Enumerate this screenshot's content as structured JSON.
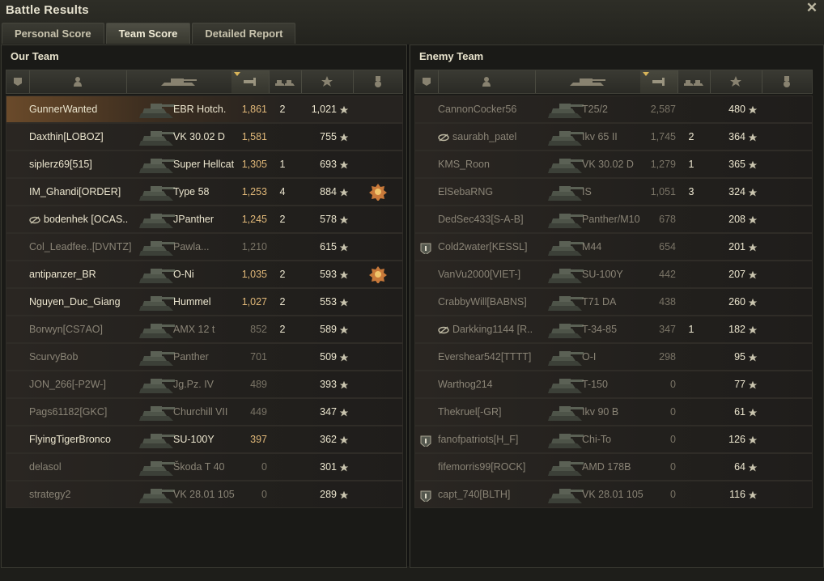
{
  "window": {
    "title": "Battle Results",
    "close_glyph": "✕"
  },
  "tabs": [
    {
      "label": "Personal Score",
      "active": false
    },
    {
      "label": "Team Score",
      "active": true
    },
    {
      "label": "Detailed Report",
      "active": false
    }
  ],
  "columns": [
    "platoon",
    "player",
    "vehicle",
    "damage",
    "kills",
    "xp",
    "medals"
  ],
  "sorted_column": "damage",
  "our_team": {
    "title": "Our Team",
    "rows": [
      {
        "name": "GunnerWanted",
        "tank": "EBR Hotch.",
        "damage": "1,861",
        "kills": "2",
        "xp": "1,021",
        "alive": true,
        "highlight": true,
        "medal": false,
        "platoon": false,
        "hidden": false
      },
      {
        "name": "Daxthin[LOBOZ]",
        "tank": "VK 30.02 D",
        "damage": "1,581",
        "kills": "",
        "xp": "755",
        "alive": true,
        "highlight": false,
        "medal": false,
        "platoon": false,
        "hidden": false
      },
      {
        "name": "siplerz69[515]",
        "tank": "Super Hellcat",
        "damage": "1,305",
        "kills": "1",
        "xp": "693",
        "alive": true,
        "highlight": false,
        "medal": false,
        "platoon": false,
        "hidden": false
      },
      {
        "name": "IM_Ghandi[ORDER]",
        "tank": "Type 58",
        "damage": "1,253",
        "kills": "4",
        "xp": "884",
        "alive": true,
        "highlight": false,
        "medal": true,
        "platoon": false,
        "hidden": false
      },
      {
        "name": "bodenhek [OCAS..",
        "tank": "JPanther",
        "damage": "1,245",
        "kills": "2",
        "xp": "578",
        "alive": true,
        "highlight": false,
        "medal": false,
        "platoon": false,
        "hidden": true
      },
      {
        "name": "Col_Leadfee..[DVNTZ]",
        "tank": "Pawla...",
        "damage": "1,210",
        "kills": "",
        "xp": "615",
        "alive": false,
        "highlight": false,
        "medal": false,
        "platoon": false,
        "hidden": false
      },
      {
        "name": "antipanzer_BR",
        "tank": "O-Ni",
        "damage": "1,035",
        "kills": "2",
        "xp": "593",
        "alive": true,
        "highlight": false,
        "medal": true,
        "platoon": false,
        "hidden": false
      },
      {
        "name": "Nguyen_Duc_Giang",
        "tank": "Hummel",
        "damage": "1,027",
        "kills": "2",
        "xp": "553",
        "alive": true,
        "highlight": false,
        "medal": false,
        "platoon": false,
        "hidden": false
      },
      {
        "name": "Borwyn[CS7AO]",
        "tank": "AMX 12 t",
        "damage": "852",
        "kills": "2",
        "xp": "589",
        "alive": false,
        "highlight": false,
        "medal": false,
        "platoon": false,
        "hidden": false
      },
      {
        "name": "ScurvyBob",
        "tank": "Panther",
        "damage": "701",
        "kills": "",
        "xp": "509",
        "alive": false,
        "highlight": false,
        "medal": false,
        "platoon": false,
        "hidden": false
      },
      {
        "name": "JON_266[-P2W-]",
        "tank": "Jg.Pz. IV",
        "damage": "489",
        "kills": "",
        "xp": "393",
        "alive": false,
        "highlight": false,
        "medal": false,
        "platoon": false,
        "hidden": false
      },
      {
        "name": "Pags61182[GKC]",
        "tank": "Churchill VII",
        "damage": "449",
        "kills": "",
        "xp": "347",
        "alive": false,
        "highlight": false,
        "medal": false,
        "platoon": false,
        "hidden": false
      },
      {
        "name": "FlyingTigerBronco",
        "tank": "SU-100Y",
        "damage": "397",
        "kills": "",
        "xp": "362",
        "alive": true,
        "highlight": false,
        "medal": false,
        "platoon": false,
        "hidden": false
      },
      {
        "name": "delasol",
        "tank": "Škoda T 40",
        "damage": "0",
        "kills": "",
        "xp": "301",
        "alive": false,
        "highlight": false,
        "medal": false,
        "platoon": false,
        "hidden": false
      },
      {
        "name": "strategy2",
        "tank": "VK 28.01 105",
        "damage": "0",
        "kills": "",
        "xp": "289",
        "alive": false,
        "highlight": false,
        "medal": false,
        "platoon": false,
        "hidden": false
      }
    ]
  },
  "enemy_team": {
    "title": "Enemy Team",
    "rows": [
      {
        "name": "CannonCocker56",
        "tank": "T25/2",
        "damage": "2,587",
        "kills": "",
        "xp": "480",
        "alive": false,
        "platoon": false,
        "hidden": false
      },
      {
        "name": "saurabh_patel",
        "tank": "Ikv 65 II",
        "damage": "1,745",
        "kills": "2",
        "xp": "364",
        "alive": false,
        "platoon": false,
        "hidden": true
      },
      {
        "name": "KMS_Roon",
        "tank": "VK 30.02 D",
        "damage": "1,279",
        "kills": "1",
        "xp": "365",
        "alive": false,
        "platoon": false,
        "hidden": false
      },
      {
        "name": "ElSebaRNG",
        "tank": "IS",
        "damage": "1,051",
        "kills": "3",
        "xp": "324",
        "alive": false,
        "platoon": false,
        "hidden": false
      },
      {
        "name": "DedSec433[S-A-B]",
        "tank": "Panther/M10",
        "damage": "678",
        "kills": "",
        "xp": "208",
        "alive": false,
        "platoon": false,
        "hidden": false
      },
      {
        "name": "Cold2water[KESSL]",
        "tank": "M44",
        "damage": "654",
        "kills": "",
        "xp": "201",
        "alive": false,
        "platoon": true,
        "hidden": false
      },
      {
        "name": "VanVu2000[VIET-]",
        "tank": "SU-100Y",
        "damage": "442",
        "kills": "",
        "xp": "207",
        "alive": false,
        "platoon": false,
        "hidden": false
      },
      {
        "name": "CrabbyWill[BABNS]",
        "tank": "T71 DA",
        "damage": "438",
        "kills": "",
        "xp": "260",
        "alive": false,
        "platoon": false,
        "hidden": false
      },
      {
        "name": "Darkking1144 [R..",
        "tank": "T-34-85",
        "damage": "347",
        "kills": "1",
        "xp": "182",
        "alive": false,
        "platoon": false,
        "hidden": true
      },
      {
        "name": "Evershear542[TTTT]",
        "tank": "O-I",
        "damage": "298",
        "kills": "",
        "xp": "95",
        "alive": false,
        "platoon": false,
        "hidden": false
      },
      {
        "name": "Warthog214",
        "tank": "T-150",
        "damage": "0",
        "kills": "",
        "xp": "77",
        "alive": false,
        "platoon": false,
        "hidden": false
      },
      {
        "name": "Thekruel[-GR]",
        "tank": "Ikv 90 B",
        "damage": "0",
        "kills": "",
        "xp": "61",
        "alive": false,
        "platoon": false,
        "hidden": false
      },
      {
        "name": "fanofpatriots[H_F]",
        "tank": "Chi-To",
        "damage": "0",
        "kills": "",
        "xp": "126",
        "alive": false,
        "platoon": true,
        "hidden": false
      },
      {
        "name": "fifemorris99[ROCK]",
        "tank": "AMD 178B",
        "damage": "0",
        "kills": "",
        "xp": "64",
        "alive": false,
        "platoon": false,
        "hidden": false
      },
      {
        "name": "capt_740[BLTH]",
        "tank": "VK 28.01 105",
        "damage": "0",
        "kills": "",
        "xp": "116",
        "alive": false,
        "platoon": true,
        "hidden": false
      }
    ]
  },
  "icons": {
    "xp": "star-icon",
    "hidden": "eye-slash-icon",
    "platoon": "platoon-badge-icon",
    "medal": "medal-icon",
    "tank": "tank-silhouette-icon"
  },
  "colors": {
    "alive_text": "#ece6cf",
    "dead_text": "#8a8476",
    "damage_alive": "#e2b979",
    "highlight_row": "#6a4a2a"
  }
}
